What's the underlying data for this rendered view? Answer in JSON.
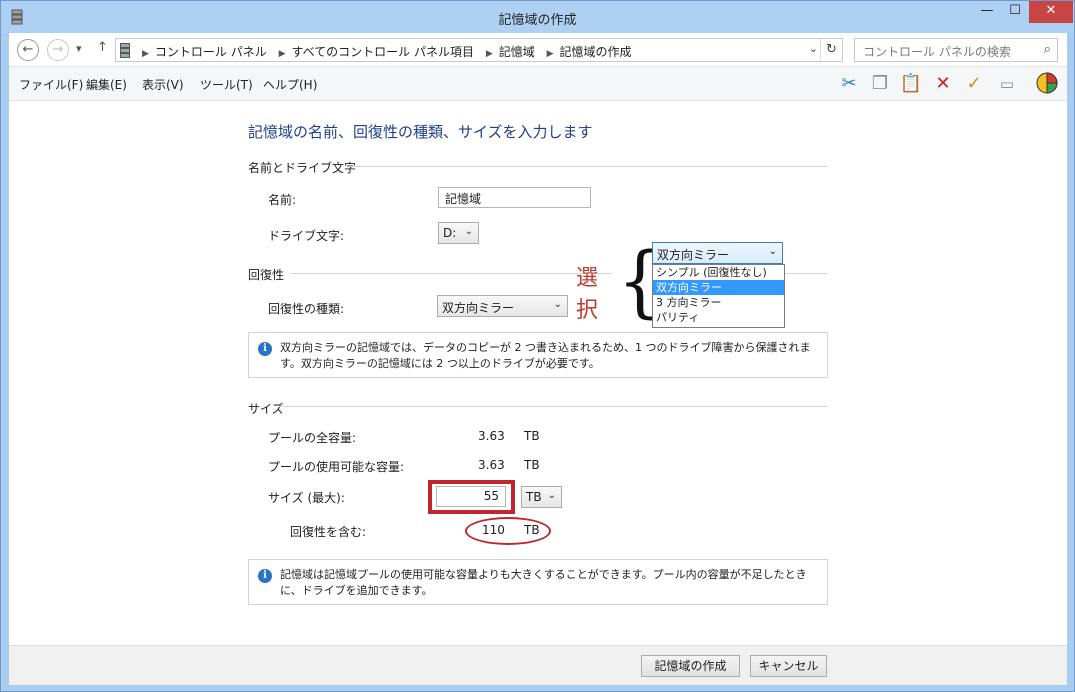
{
  "window": {
    "title": "記憶域の作成"
  },
  "address": {
    "crumbs": [
      "コントロール パネル",
      "すべてのコントロール パネル項目",
      "記憶域",
      "記憶域の作成"
    ],
    "search_placeholder": "コントロール パネルの検索"
  },
  "menu": {
    "items": [
      "ファイル(F)",
      "編集(E)",
      "表示(V)",
      "ツール(T)",
      "ヘルプ(H)"
    ]
  },
  "toolbar_icons": [
    "scissors-icon",
    "copy-icon",
    "paste-icon",
    "delete-icon",
    "check-icon",
    "rename-icon",
    "properties-icon"
  ],
  "form": {
    "heading": "記憶域の名前、回復性の種類、サイズを入力します",
    "name_section": {
      "title": "名前とドライブ文字",
      "name_label": "名前:",
      "name_value": "記憶域",
      "drive_label": "ドライブ文字:",
      "drive_value": "D:"
    },
    "resiliency_section": {
      "title": "回復性",
      "type_label": "回復性の種類:",
      "type_value": "双方向ミラー",
      "info": "双方向ミラーの記憶域では、データのコピーが 2 つ書き込まれるため、1 つのドライブ障害から保護されます。双方向ミラーの記憶域には 2 つ以上のドライブが必要です。"
    },
    "size_section": {
      "title": "サイズ",
      "total_label": "プールの全容量:",
      "total_value": "3.63",
      "total_unit": "TB",
      "available_label": "プールの使用可能な容量:",
      "available_value": "3.63",
      "available_unit": "TB",
      "size_label": "サイズ (最大):",
      "size_value": "55",
      "size_unit": "TB",
      "resiliency_label": "回復性を含む:",
      "resiliency_value": "110",
      "resiliency_unit": "TB",
      "info": "記憶域は記憶域プールの使用可能な容量よりも大きくすることができます。プール内の容量が不足したときに、ドライブを追加できます。"
    }
  },
  "dropdown_popup": {
    "selected": "双方向ミラー",
    "options": [
      "シンプル (回復性なし)",
      "双方向ミラー",
      "3 方向ミラー",
      "パリティ"
    ],
    "highlighted_index": 1
  },
  "annotation": {
    "char1": "選",
    "char2": "択",
    "color": "#c0392b"
  },
  "buttons": {
    "create": "記憶域の作成",
    "cancel": "キャンセル"
  },
  "colors": {
    "accent": "#1e3f8c",
    "selection": "#3399ff",
    "highlight_red": "#c0262b"
  }
}
